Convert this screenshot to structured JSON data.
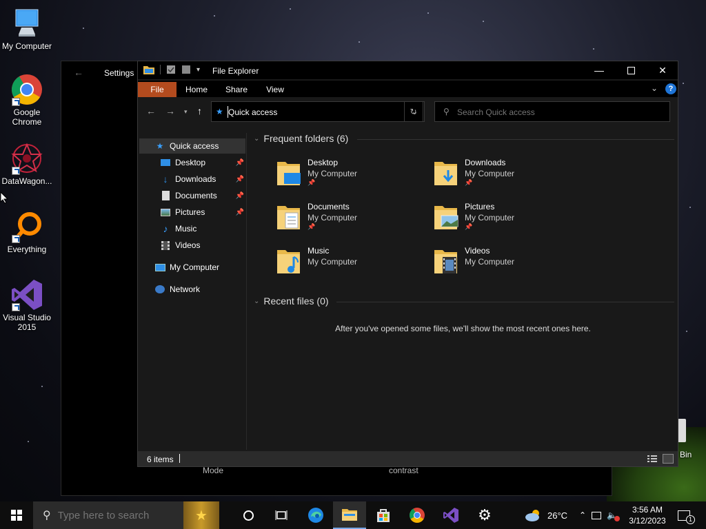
{
  "desktop": {
    "icons": [
      {
        "label": "My Computer",
        "icon": "monitor-icon"
      },
      {
        "label": "Google Chrome",
        "icon": "chrome-icon"
      },
      {
        "label": "DataWagon...",
        "icon": "datawagon-icon"
      },
      {
        "label": "Everything",
        "icon": "everything-icon"
      },
      {
        "label": "Visual Studio 2015",
        "icon": "visual-studio-icon"
      }
    ],
    "recycle_bin_label": "Bin"
  },
  "settings_window": {
    "title": "Settings",
    "mode_label": "Mode",
    "contrast_label": "contrast"
  },
  "explorer": {
    "title": "File Explorer",
    "ribbon_tabs": [
      "File",
      "Home",
      "Share",
      "View"
    ],
    "address": "Quick access",
    "search_placeholder": "Search Quick access",
    "nav": {
      "quick_access": "Quick access",
      "pinned": [
        {
          "label": "Desktop",
          "pinned": true
        },
        {
          "label": "Downloads",
          "pinned": true
        },
        {
          "label": "Documents",
          "pinned": true
        },
        {
          "label": "Pictures",
          "pinned": true
        },
        {
          "label": "Music",
          "pinned": false
        },
        {
          "label": "Videos",
          "pinned": false
        }
      ],
      "my_computer": "My Computer",
      "network": "Network"
    },
    "frequent_header": "Frequent folders (6)",
    "frequent": [
      {
        "name": "Desktop",
        "location": "My Computer",
        "pinned": true
      },
      {
        "name": "Downloads",
        "location": "My Computer",
        "pinned": true
      },
      {
        "name": "Documents",
        "location": "My Computer",
        "pinned": true
      },
      {
        "name": "Pictures",
        "location": "My Computer",
        "pinned": true
      },
      {
        "name": "Music",
        "location": "My Computer",
        "pinned": false
      },
      {
        "name": "Videos",
        "location": "My Computer",
        "pinned": false
      }
    ],
    "recent_header": "Recent files (0)",
    "recent_empty": "After you've opened some files, we'll show the most recent ones here.",
    "status_items": "6 items"
  },
  "taskbar": {
    "search_placeholder": "Type here to search",
    "weather": "26°C",
    "time": "3:56 AM",
    "date": "3/12/2023",
    "notification_count": "1"
  },
  "colors": {
    "file_tab": "#b34b1e",
    "accent": "#3aa0ff",
    "taskbar_active": "#7aa8e8"
  }
}
